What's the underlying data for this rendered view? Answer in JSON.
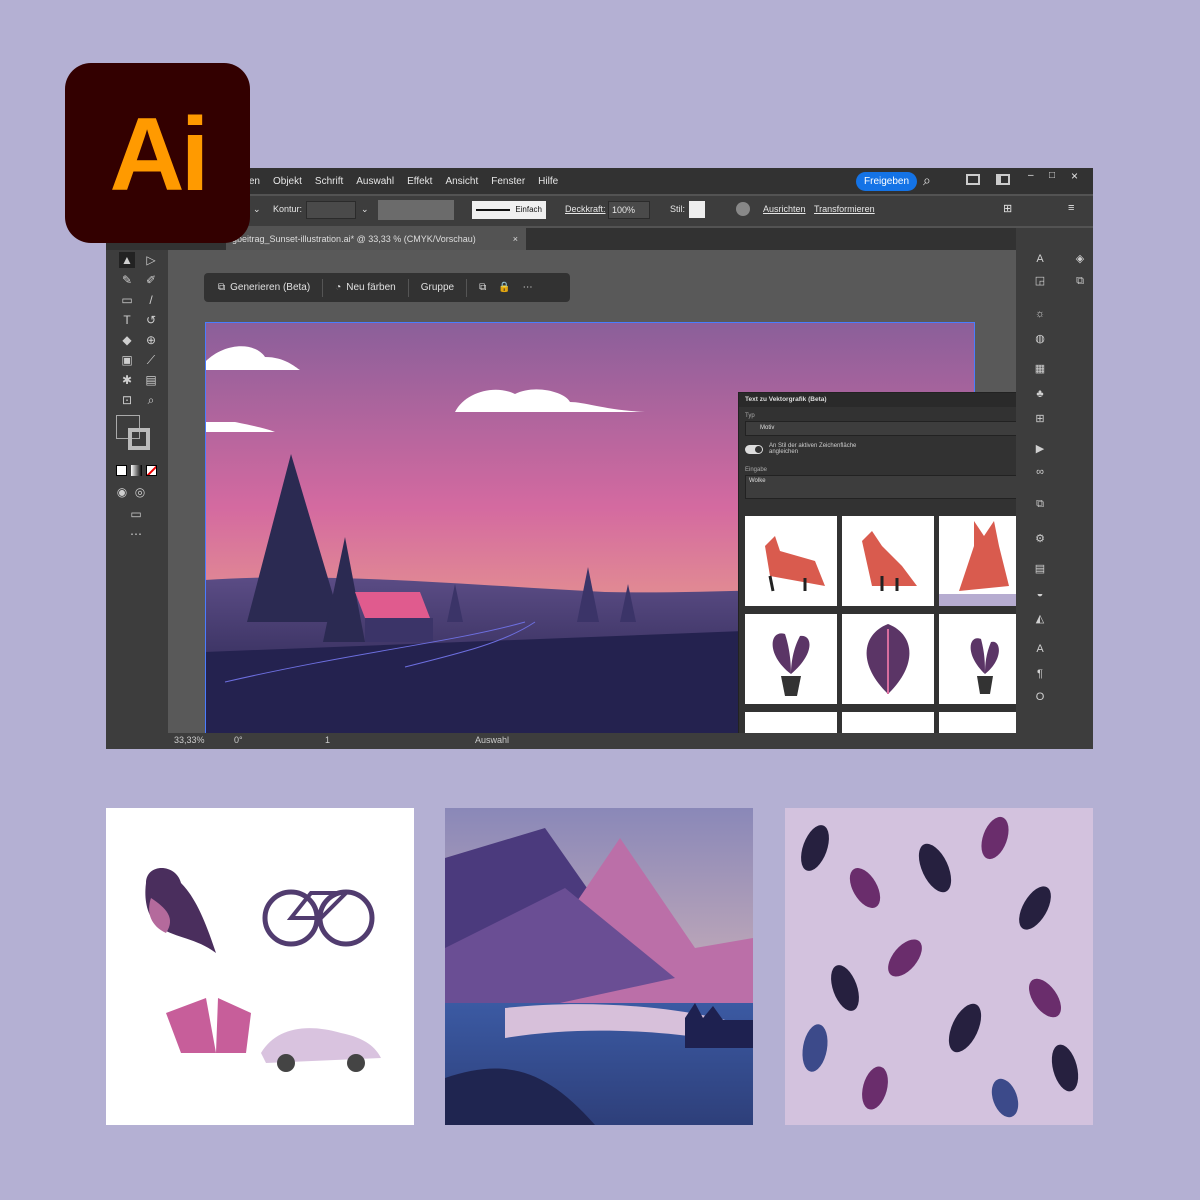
{
  "app": {
    "logo_text": "Ai",
    "accent": "#ff9a00",
    "logo_bg": "#330000"
  },
  "menu": {
    "items": [
      "Bearbeiten",
      "Objekt",
      "Schrift",
      "Auswahl",
      "Effekt",
      "Ansicht",
      "Fenster",
      "Hilfe"
    ],
    "share": "Freigeben"
  },
  "toolbar": {
    "kontur_label": "Kontur:",
    "stroke_style": "Einfach",
    "opacity_label": "Deckkraft:",
    "opacity_value": "100%",
    "style_label": "Stil:",
    "align_link": "Ausrichten",
    "transform_link": "Transformieren"
  },
  "tab": {
    "title": "gbeitrag_Sunset-illustration.ai* @ 33,33 % (CMYK/Vorschau)",
    "close": "×"
  },
  "context_bar": {
    "generate": "Generieren (Beta)",
    "recolor": "Neu färben",
    "group": "Gruppe"
  },
  "panel": {
    "title": "Text zu Vektorgrafik (Beta)",
    "type_label": "Typ",
    "type_value": "Motiv",
    "toggle_label": "An Stil der aktiven Zeichenfläche angleichen",
    "prompt_label": "Eingabe",
    "prompt_value": "Wolke",
    "close": "×"
  },
  "status": {
    "zoom": "33,33%",
    "rotation": "0°",
    "artboard": "1",
    "mode": "Auswahl"
  },
  "icons": [
    "selection-tool-icon",
    "direct-selection-icon",
    "pen-icon",
    "type-icon",
    "rectangle-icon",
    "brush-icon",
    "eraser-icon",
    "rotate-icon",
    "eyedropper-icon",
    "zoom-icon",
    "search-icon",
    "layers-icon",
    "properties-icon"
  ]
}
